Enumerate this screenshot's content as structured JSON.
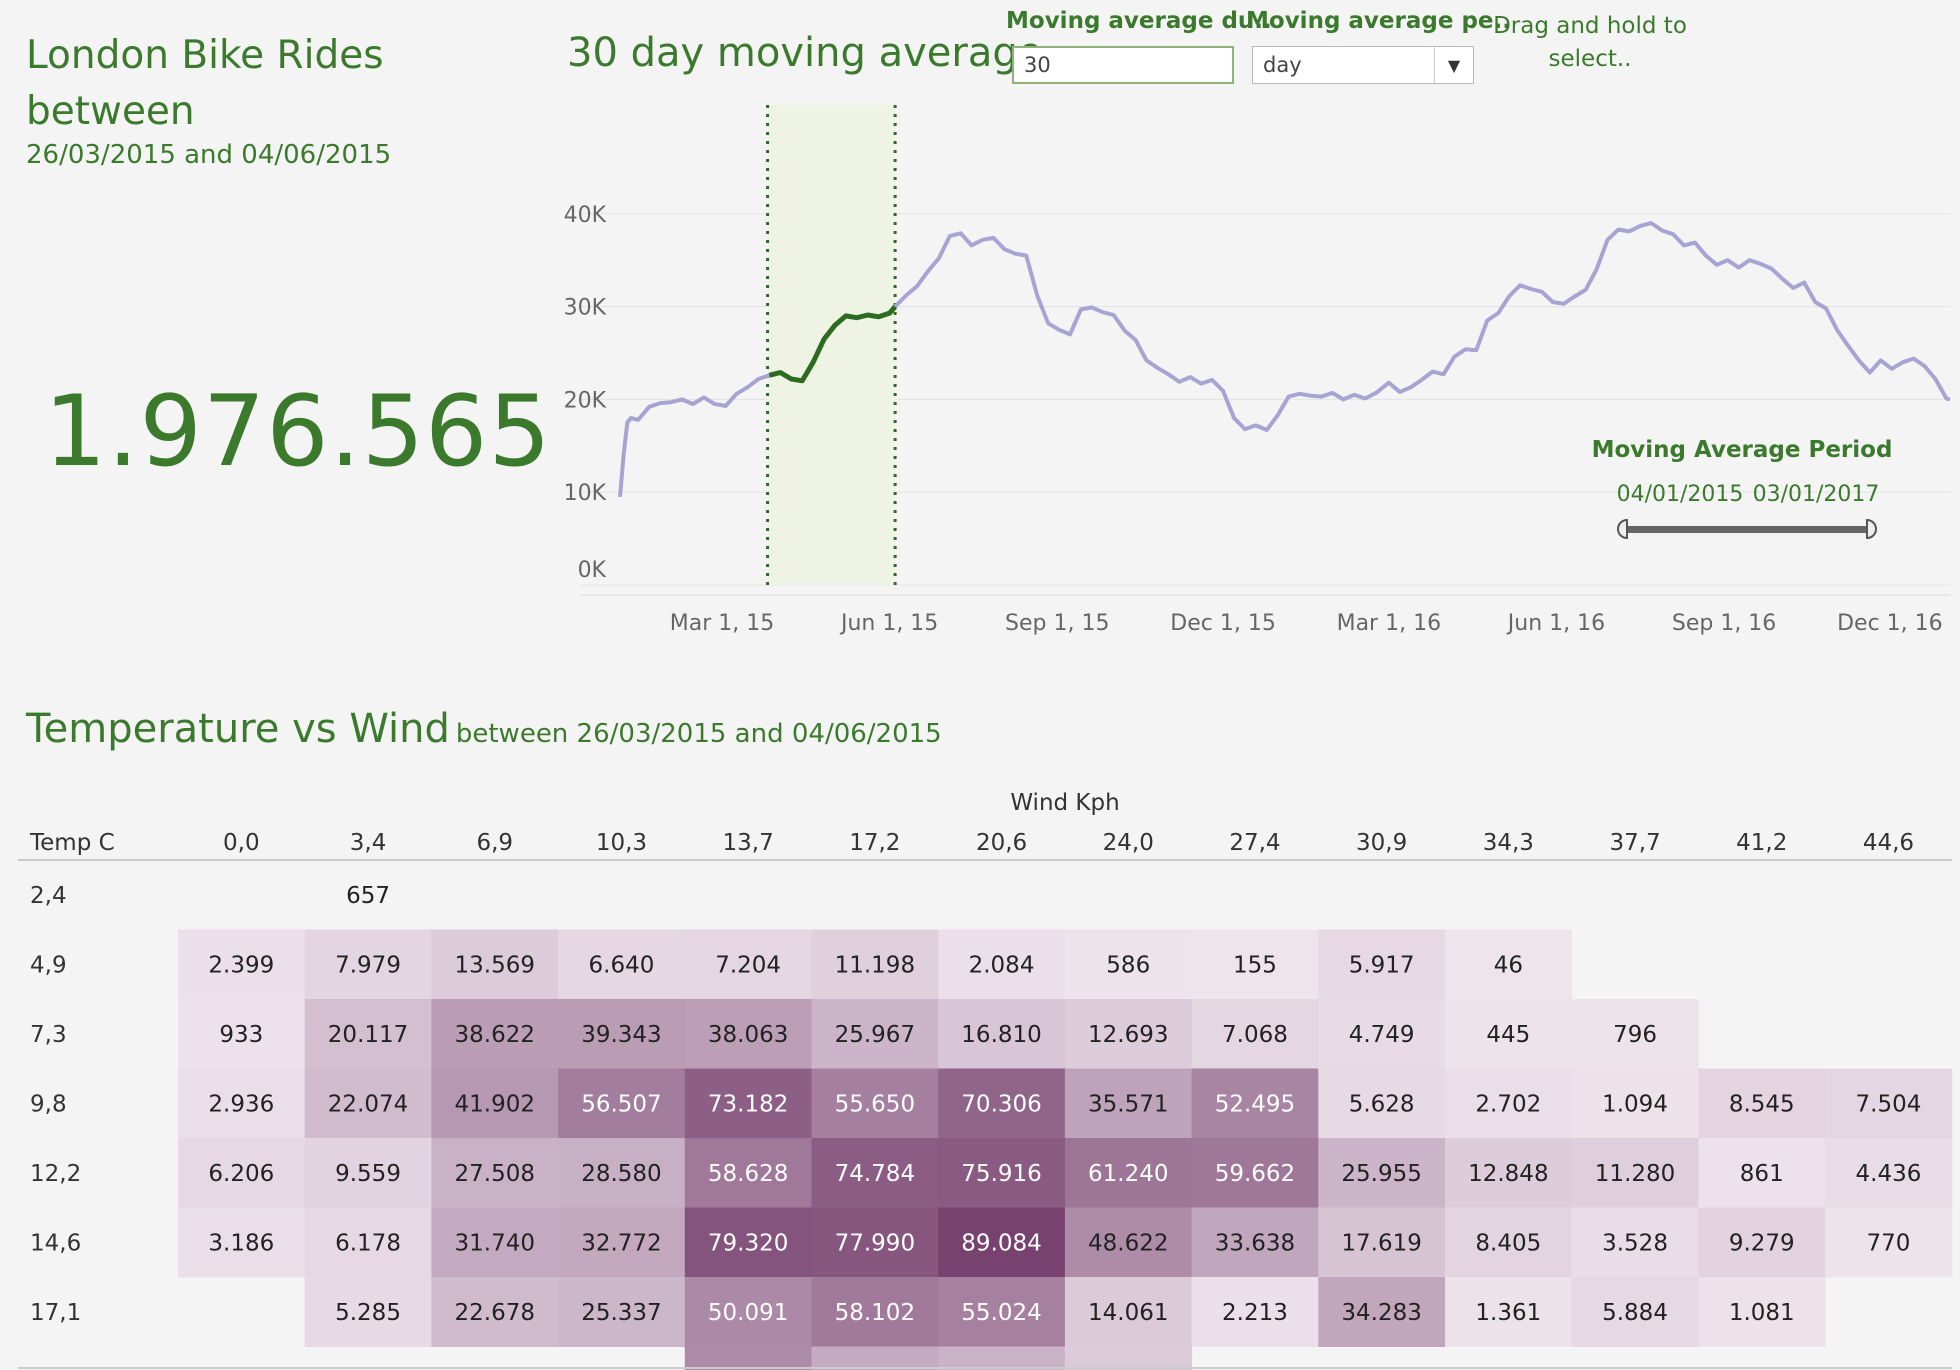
{
  "kpi": {
    "title": "London Bike Rides between",
    "subtitle": "26/03/2015 and 04/06/2015",
    "value": "1.976.565"
  },
  "line_chart": {
    "title": "30 day moving average"
  },
  "controls": {
    "duration_label": "Moving average du..",
    "duration_value": "30",
    "period_label": "Moving average pe..",
    "period_value": "day",
    "drag_hint": "Drag and hold to select..",
    "slider_title": "Moving Average Period",
    "slider_start": "04/01/2015",
    "slider_end": "03/01/2017"
  },
  "heatmap": {
    "title": "Temperature vs Wind",
    "subtitle": "between 26/03/2015 and 04/06/2015"
  },
  "colors": {
    "accent_green": "#3b7a2d",
    "line_purple": "#a9a3d3",
    "selection_fill": "#eef3e3"
  },
  "chart_data": [
    {
      "type": "line",
      "title": "30 day moving average",
      "xlabel": "",
      "ylabel": "",
      "ylim": [
        0,
        40000
      ],
      "y_ticks": [
        "0K",
        "10K",
        "20K",
        "30K",
        "40K"
      ],
      "x_ticks": [
        "Mar 1, 15",
        "Jun 1, 15",
        "Sep 1, 15",
        "Dec 1, 15",
        "Mar 1, 16",
        "Jun 1, 16",
        "Sep 1, 16",
        "Dec 1, 16"
      ],
      "x_start": "2015-01-04",
      "x_end": "2017-01-03",
      "selection": {
        "from": "2015-03-26",
        "to": "2015-06-04"
      },
      "grid": true,
      "series": [
        {
          "x": [
            "2015-01-04",
            "2015-01-06",
            "2015-01-08",
            "2015-01-10",
            "2015-01-14",
            "2015-01-20",
            "2015-01-26",
            "2015-02-01",
            "2015-02-07",
            "2015-02-13",
            "2015-02-19",
            "2015-02-25",
            "2015-03-03",
            "2015-03-09",
            "2015-03-15",
            "2015-03-21",
            "2015-03-27",
            "2015-04-02",
            "2015-04-08",
            "2015-04-14",
            "2015-04-20",
            "2015-04-26",
            "2015-05-02",
            "2015-05-08",
            "2015-05-14",
            "2015-05-20",
            "2015-05-26",
            "2015-06-01",
            "2015-06-04",
            "2015-06-10",
            "2015-06-16",
            "2015-06-22",
            "2015-06-28",
            "2015-07-04",
            "2015-07-10",
            "2015-07-16",
            "2015-07-22",
            "2015-07-28",
            "2015-08-03",
            "2015-08-09",
            "2015-08-15",
            "2015-08-21",
            "2015-08-27",
            "2015-09-02",
            "2015-09-08",
            "2015-09-14",
            "2015-09-20",
            "2015-09-26",
            "2015-10-02",
            "2015-10-08",
            "2015-10-14",
            "2015-10-20",
            "2015-10-26",
            "2015-11-01",
            "2015-11-07",
            "2015-11-13",
            "2015-11-19",
            "2015-11-25",
            "2015-12-01",
            "2015-12-07",
            "2015-12-13",
            "2015-12-19",
            "2015-12-25",
            "2015-12-31",
            "2016-01-06",
            "2016-01-12",
            "2016-01-18",
            "2016-01-24",
            "2016-01-30",
            "2016-02-05",
            "2016-02-11",
            "2016-02-17",
            "2016-02-23",
            "2016-03-01",
            "2016-03-07",
            "2016-03-13",
            "2016-03-19",
            "2016-03-25",
            "2016-03-31",
            "2016-04-06",
            "2016-04-12",
            "2016-04-18",
            "2016-04-24",
            "2016-04-30",
            "2016-05-06",
            "2016-05-12",
            "2016-05-18",
            "2016-05-24",
            "2016-05-30",
            "2016-06-05",
            "2016-06-11",
            "2016-06-17",
            "2016-06-23",
            "2016-06-29",
            "2016-07-05",
            "2016-07-11",
            "2016-07-17",
            "2016-07-23",
            "2016-07-29",
            "2016-08-04",
            "2016-08-10",
            "2016-08-16",
            "2016-08-22",
            "2016-08-28",
            "2016-09-03",
            "2016-09-09",
            "2016-09-15",
            "2016-09-21",
            "2016-09-27",
            "2016-10-03",
            "2016-10-09",
            "2016-10-15",
            "2016-10-21",
            "2016-10-27",
            "2016-11-02",
            "2016-11-08",
            "2016-11-14",
            "2016-11-20",
            "2016-11-26",
            "2016-12-02",
            "2016-12-08",
            "2016-12-14",
            "2016-12-20",
            "2016-12-26",
            "2017-01-01",
            "2017-01-03"
          ],
          "y": [
            9500,
            14000,
            17500,
            18000,
            17800,
            19200,
            19600,
            19700,
            20000,
            19500,
            20200,
            19500,
            19300,
            20600,
            21300,
            22200,
            22600,
            22900,
            22200,
            22000,
            24000,
            26500,
            28000,
            29000,
            28800,
            29100,
            28900,
            29300,
            30000,
            31200,
            32200,
            33800,
            35200,
            37600,
            37900,
            36600,
            37200,
            37400,
            36200,
            35700,
            35500,
            31200,
            28200,
            27500,
            27000,
            29700,
            29900,
            29400,
            29100,
            27400,
            26400,
            24200,
            23400,
            22700,
            21900,
            22400,
            21700,
            22100,
            20900,
            18000,
            16800,
            17200,
            16700,
            18300,
            20300,
            20600,
            20400,
            20300,
            20700,
            20000,
            20500,
            20100,
            20700,
            21800,
            20800,
            21300,
            22100,
            23000,
            22700,
            24600,
            25400,
            25300,
            28500,
            29300,
            31100,
            32300,
            31900,
            31600,
            30500,
            30300,
            31100,
            31800,
            34000,
            37200,
            38300,
            38100,
            38700,
            39000,
            38200,
            37800,
            36600,
            36900,
            35500,
            34500,
            35000,
            34200,
            35000,
            34600,
            34100,
            33000,
            32000,
            32600,
            30500,
            29800,
            27500,
            25800,
            24200,
            22900,
            24200,
            23300,
            24000,
            24400,
            23600,
            22200,
            20100,
            20000
          ]
        }
      ]
    },
    {
      "type": "heatmap",
      "title": "Temperature vs Wind",
      "xlabel": "Wind Kph",
      "ylabel": "Temp C",
      "x": [
        "0,0",
        "3,4",
        "6,9",
        "10,3",
        "13,7",
        "17,2",
        "20,6",
        "24,0",
        "27,4",
        "30,9",
        "34,3",
        "37,7",
        "41,2",
        "44,6"
      ],
      "y": [
        "2,4",
        "4,9",
        "7,3",
        "9,8",
        "12,2",
        "14,6",
        "17,1"
      ],
      "values": [
        [
          null,
          657,
          null,
          null,
          null,
          null,
          null,
          null,
          null,
          null,
          null,
          null,
          null,
          null
        ],
        [
          2399,
          7979,
          13569,
          6640,
          7204,
          11198,
          2084,
          586,
          155,
          5917,
          46,
          null,
          null,
          null
        ],
        [
          933,
          20117,
          38622,
          39343,
          38063,
          25967,
          16810,
          12693,
          7068,
          4749,
          445,
          796,
          null,
          null
        ],
        [
          2936,
          22074,
          41902,
          56507,
          73182,
          55650,
          70306,
          35571,
          52495,
          5628,
          2702,
          1094,
          8545,
          7504
        ],
        [
          6206,
          9559,
          27508,
          28580,
          58628,
          74784,
          75916,
          61240,
          59662,
          25955,
          12848,
          11280,
          861,
          4436
        ],
        [
          3186,
          6178,
          31740,
          32772,
          79320,
          77990,
          89084,
          48622,
          33638,
          17619,
          8405,
          3528,
          9279,
          770
        ],
        [
          null,
          5285,
          22678,
          25337,
          50091,
          58102,
          55024,
          14061,
          2213,
          34283,
          1361,
          5884,
          1081,
          null
        ]
      ],
      "display_values": [
        [
          "",
          "657",
          "",
          "",
          "",
          "",
          "",
          "",
          "",
          "",
          "",
          "",
          "",
          ""
        ],
        [
          "2.399",
          "7.979",
          "13.569",
          "6.640",
          "7.204",
          "11.198",
          "2.084",
          "586",
          "155",
          "5.917",
          "46",
          "",
          "",
          ""
        ],
        [
          "933",
          "20.117",
          "38.622",
          "39.343",
          "38.063",
          "25.967",
          "16.810",
          "12.693",
          "7.068",
          "4.749",
          "445",
          "796",
          "",
          ""
        ],
        [
          "2.936",
          "22.074",
          "41.902",
          "56.507",
          "73.182",
          "55.650",
          "70.306",
          "35.571",
          "52.495",
          "5.628",
          "2.702",
          "1.094",
          "8.545",
          "7.504"
        ],
        [
          "6.206",
          "9.559",
          "27.508",
          "28.580",
          "58.628",
          "74.784",
          "75.916",
          "61.240",
          "59.662",
          "25.955",
          "12.848",
          "11.280",
          "861",
          "4.436"
        ],
        [
          "3.186",
          "6.178",
          "31.740",
          "32.772",
          "79.320",
          "77.990",
          "89.084",
          "48.622",
          "33.638",
          "17.619",
          "8.405",
          "3.528",
          "9.279",
          "770"
        ],
        [
          "",
          "5.285",
          "22.678",
          "25.337",
          "50.091",
          "58.102",
          "55.024",
          "14.061",
          "2.213",
          "34.283",
          "1.361",
          "5.884",
          "1.081",
          ""
        ]
      ]
    }
  ]
}
